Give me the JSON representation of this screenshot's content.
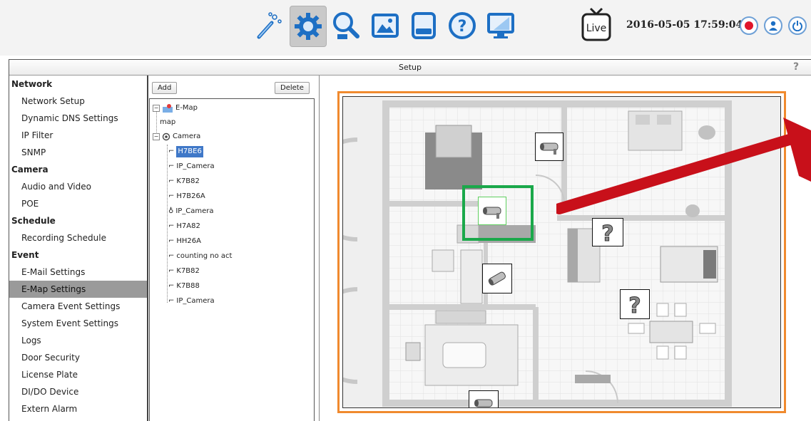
{
  "toolbar": {
    "tools": [
      {
        "name": "wizard-icon"
      },
      {
        "name": "setup-gear-icon",
        "active": true
      },
      {
        "name": "search-playback-icon"
      },
      {
        "name": "emap-image-icon"
      },
      {
        "name": "storage-icon"
      },
      {
        "name": "help-icon"
      },
      {
        "name": "monitor-icon"
      }
    ],
    "live_label": "Live",
    "datetime": "2016-05-05 17:59:04",
    "accent": "#f08a2e"
  },
  "setup": {
    "title": "Setup",
    "help_glyph": "?"
  },
  "sidebar": {
    "sections": [
      {
        "header": "Network",
        "items": [
          "Network Setup",
          "Dynamic DNS Settings",
          "IP Filter",
          "SNMP"
        ]
      },
      {
        "header": "Camera",
        "items": [
          "Audio and Video",
          "POE"
        ]
      },
      {
        "header": "Schedule",
        "items": [
          "Recording Schedule"
        ]
      },
      {
        "header": "Event",
        "items": [
          "E-Mail Settings",
          "E-Map Settings",
          "Camera Event Settings",
          "System Event Settings",
          "Logs",
          "Door Security",
          "License Plate",
          "DI/DO Device",
          "Extern Alarm"
        ]
      }
    ],
    "selected": "E-Map Settings"
  },
  "tree": {
    "add_label": "Add",
    "delete_label": "Delete",
    "emap_label": "E-Map",
    "map_label": "map",
    "camera_root_label": "Camera",
    "cameras": [
      "H7BE6",
      "IP_Camera",
      "K7B82",
      "H7B26A",
      "IP_Camera",
      "H7A82",
      "HH26A",
      "counting no act",
      "K7B82",
      "K7B88",
      "IP_Camera"
    ],
    "selected_camera": "H7BE6"
  },
  "map": {
    "markers": [
      {
        "kind": "camera",
        "highlighted": false
      },
      {
        "kind": "camera",
        "highlighted": true
      },
      {
        "kind": "unknown",
        "highlighted": false
      },
      {
        "kind": "camera",
        "highlighted": false
      },
      {
        "kind": "unknown",
        "highlighted": false
      },
      {
        "kind": "camera",
        "highlighted": false
      }
    ],
    "highlight_color": "#1aa84a",
    "arrow_color": "#c8101a"
  }
}
